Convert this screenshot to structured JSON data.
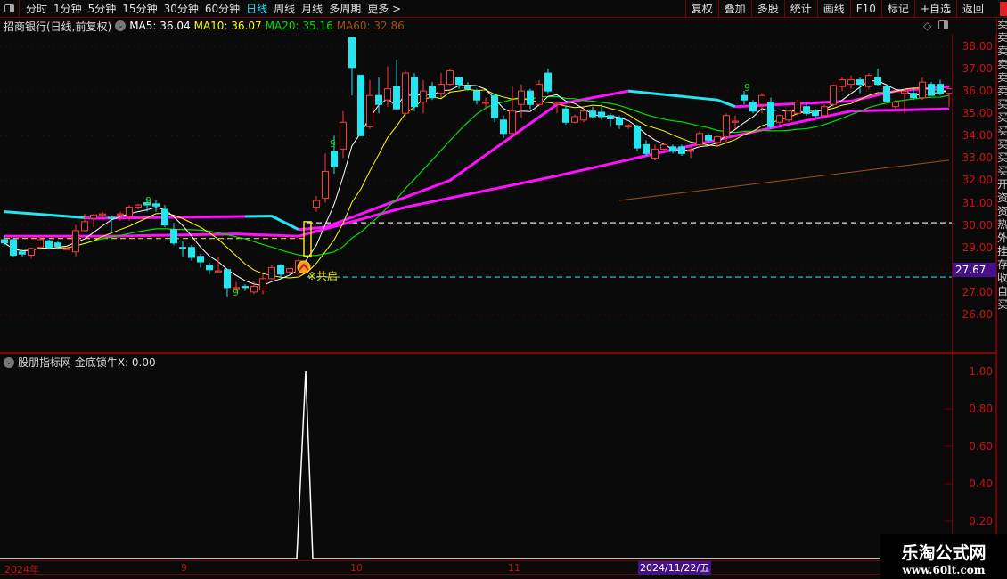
{
  "toolbar": {
    "periods": [
      "分时",
      "1分钟",
      "5分钟",
      "15分钟",
      "30分钟",
      "60分钟",
      "日线",
      "周线",
      "月线",
      "多周期",
      "更多 >"
    ],
    "active_period": "日线",
    "right_buttons": [
      "复权",
      "叠加",
      "多股",
      "统计",
      "画线",
      "F10",
      "标记",
      "+自选",
      "返回"
    ]
  },
  "title": {
    "stock": "招商银行(日线,前复权)",
    "ma5": "MA5: 36.04",
    "ma10": "MA10: 36.07",
    "ma20": "MA20: 35.16",
    "ma60": "MA60: 32.86"
  },
  "colors": {
    "up": "#ff3b3b",
    "down": "#22e6f0",
    "ma5": "#ffffff",
    "ma10": "#ffff00",
    "ma20": "#00e000",
    "ma60": "#a0501a",
    "band": "#ff10ff",
    "grid": "#6a0000",
    "accent": "#45108a"
  },
  "price_axis": [
    "38.00",
    "37.00",
    "36.00",
    "35.00",
    "34.00",
    "33.00",
    "32.00",
    "31.00",
    "30.00",
    "29.00",
    "27.00",
    "26.00"
  ],
  "current_price_tag": "27.67",
  "signal_label": "※共启",
  "nine_labels": [
    "9",
    "9",
    "9",
    "9"
  ],
  "right_strip": "卖卖卖卖卖卖买买买买买买开资资热外挂存收自买",
  "indicator": {
    "title": "股朋指标网 金底锁牛X: 0.00",
    "axis": [
      "1.00",
      "0.80",
      "0.60",
      "0.40",
      "0.20"
    ]
  },
  "date_axis": {
    "labels": [
      "2024年",
      "9",
      "10",
      "11"
    ],
    "selected": "2024/11/22/五"
  },
  "watermark": {
    "line1": "乐淘公式网",
    "line2": "www.60lt.com"
  },
  "chart_data": {
    "type": "candlestick",
    "ylim": [
      25.3,
      38.6
    ],
    "ohlc": [
      [
        29.35,
        29.5,
        29.1,
        29.2
      ],
      [
        29.35,
        29.4,
        28.55,
        28.65
      ],
      [
        28.8,
        28.9,
        28.6,
        28.7
      ],
      [
        28.65,
        29.0,
        28.5,
        28.95
      ],
      [
        29.0,
        29.5,
        28.9,
        29.35
      ],
      [
        29.3,
        29.35,
        28.9,
        29.0
      ],
      [
        29.2,
        29.3,
        28.9,
        29.05
      ],
      [
        28.95,
        29.0,
        28.9,
        28.95
      ],
      [
        28.8,
        30.0,
        28.6,
        29.75
      ],
      [
        29.75,
        30.5,
        29.7,
        30.15
      ],
      [
        30.3,
        30.5,
        29.9,
        30.45
      ],
      [
        30.45,
        30.6,
        30.3,
        30.5
      ],
      [
        30.35,
        30.4,
        29.6,
        30.3
      ],
      [
        30.45,
        30.6,
        30.2,
        30.5
      ],
      [
        30.4,
        30.9,
        30.2,
        30.8
      ],
      [
        30.8,
        30.95,
        30.7,
        30.9
      ],
      [
        31.0,
        31.2,
        30.6,
        30.9
      ],
      [
        30.95,
        31.1,
        30.6,
        30.85
      ],
      [
        30.7,
        30.9,
        29.9,
        30.0
      ],
      [
        29.8,
        30.1,
        29.1,
        29.2
      ],
      [
        29.0,
        29.3,
        28.6,
        28.95
      ],
      [
        29.0,
        29.1,
        28.4,
        28.55
      ],
      [
        28.6,
        28.7,
        28.1,
        28.35
      ],
      [
        28.2,
        28.3,
        27.8,
        28.0
      ],
      [
        27.9,
        28.6,
        27.9,
        27.95
      ],
      [
        28.0,
        28.0,
        26.8,
        27.2
      ],
      [
        27.2,
        27.45,
        27.0,
        27.2
      ],
      [
        27.25,
        27.35,
        27.05,
        27.2
      ],
      [
        27.0,
        27.5,
        26.9,
        27.25
      ],
      [
        27.1,
        27.8,
        26.9,
        27.6
      ],
      [
        27.6,
        28.2,
        27.55,
        28.1
      ],
      [
        28.2,
        28.25,
        27.6,
        27.8
      ],
      [
        27.9,
        28.05,
        27.8,
        28.05
      ],
      [
        27.85,
        28.5,
        27.8,
        28.4
      ],
      [
        28.6,
        30.15,
        28.6,
        30.15
      ],
      [
        30.8,
        31.3,
        30.6,
        31.1
      ],
      [
        31.2,
        33.2,
        31.0,
        32.4
      ],
      [
        33.3,
        34.0,
        32.3,
        32.6
      ],
      [
        33.4,
        35.1,
        33.0,
        34.6
      ],
      [
        38.4,
        38.4,
        35.8,
        37.05
      ],
      [
        36.7,
        36.7,
        34.0,
        34.0
      ],
      [
        34.4,
        36.5,
        34.3,
        35.8
      ],
      [
        35.8,
        36.6,
        35.0,
        35.4
      ],
      [
        35.6,
        37.1,
        35.3,
        36.1
      ],
      [
        36.2,
        37.4,
        35.3,
        35.2
      ],
      [
        35.0,
        36.9,
        34.9,
        36.8
      ],
      [
        36.6,
        36.8,
        35.1,
        35.3
      ],
      [
        35.5,
        36.5,
        35.0,
        36.0
      ],
      [
        36.2,
        36.4,
        35.6,
        35.7
      ],
      [
        35.9,
        36.8,
        35.7,
        36.3
      ],
      [
        36.3,
        37.0,
        36.2,
        36.9
      ],
      [
        36.6,
        36.6,
        36.1,
        36.3
      ],
      [
        36.2,
        36.4,
        36.0,
        36.1
      ],
      [
        36.0,
        36.1,
        35.4,
        35.6
      ],
      [
        35.5,
        35.7,
        35.2,
        35.5
      ],
      [
        35.8,
        35.9,
        34.6,
        34.8
      ],
      [
        34.7,
        34.9,
        33.9,
        34.1
      ],
      [
        34.1,
        36.2,
        34.1,
        35.1
      ],
      [
        35.4,
        36.3,
        34.8,
        36.0
      ],
      [
        36.0,
        36.1,
        35.2,
        35.4
      ],
      [
        35.4,
        36.5,
        35.3,
        36.3
      ],
      [
        36.8,
        37.0,
        35.9,
        36.0
      ],
      [
        35.4,
        35.5,
        35.0,
        35.45
      ],
      [
        35.2,
        35.3,
        34.5,
        34.6
      ],
      [
        34.6,
        34.95,
        34.55,
        34.85
      ],
      [
        34.7,
        35.2,
        34.6,
        35.1
      ],
      [
        35.1,
        35.3,
        34.8,
        34.85
      ],
      [
        35.05,
        35.4,
        34.7,
        34.85
      ],
      [
        34.9,
        35.0,
        34.4,
        34.75
      ],
      [
        34.8,
        34.9,
        34.3,
        34.5
      ],
      [
        34.4,
        34.5,
        34.3,
        34.45
      ],
      [
        34.4,
        34.5,
        33.3,
        33.45
      ],
      [
        33.6,
        33.8,
        33.1,
        33.2
      ],
      [
        33.0,
        33.6,
        32.9,
        33.4
      ],
      [
        33.4,
        33.7,
        33.3,
        33.6
      ],
      [
        33.5,
        33.6,
        33.2,
        33.3
      ],
      [
        33.5,
        33.6,
        33.1,
        33.2
      ],
      [
        33.3,
        33.5,
        33.0,
        33.35
      ],
      [
        33.6,
        34.2,
        33.5,
        34.1
      ],
      [
        34.0,
        34.1,
        33.7,
        33.8
      ],
      [
        33.7,
        34.0,
        33.5,
        33.95
      ],
      [
        33.95,
        35.0,
        33.7,
        34.9
      ],
      [
        34.6,
        34.9,
        34.3,
        34.65
      ],
      [
        35.8,
        36.0,
        35.4,
        35.6
      ],
      [
        35.5,
        35.6,
        35.0,
        35.1
      ],
      [
        35.4,
        35.9,
        35.0,
        35.8
      ],
      [
        35.5,
        35.7,
        34.3,
        34.4
      ],
      [
        34.6,
        34.95,
        34.5,
        34.9
      ],
      [
        34.7,
        35.15,
        34.6,
        35.1
      ],
      [
        35.0,
        35.6,
        34.9,
        35.5
      ],
      [
        35.3,
        35.4,
        34.9,
        35.0
      ],
      [
        35.1,
        35.2,
        34.8,
        34.9
      ],
      [
        34.9,
        35.4,
        34.8,
        35.3
      ],
      [
        35.4,
        36.3,
        35.3,
        36.25
      ],
      [
        36.2,
        36.6,
        36.0,
        36.5
      ],
      [
        36.3,
        36.7,
        36.1,
        36.5
      ],
      [
        36.5,
        36.6,
        35.9,
        36.3
      ],
      [
        36.2,
        36.8,
        36.1,
        36.7
      ],
      [
        36.6,
        37.0,
        36.2,
        36.3
      ],
      [
        36.2,
        36.3,
        35.5,
        35.55
      ],
      [
        35.3,
        35.6,
        35.2,
        35.5
      ],
      [
        35.9,
        36.1,
        35.0,
        36.0
      ],
      [
        35.9,
        36.1,
        35.6,
        35.7
      ],
      [
        35.7,
        36.6,
        35.6,
        36.4
      ],
      [
        36.3,
        36.4,
        35.8,
        35.8
      ],
      [
        36.3,
        36.5,
        35.8,
        35.9
      ],
      [
        35.9,
        36.1,
        35.3,
        36.1
      ]
    ],
    "signal_index": 34,
    "upper_band": [
      [
        0,
        30.6
      ],
      [
        10,
        30.3
      ],
      [
        30,
        30.4
      ],
      [
        33,
        29.8
      ],
      [
        36,
        29.9
      ],
      [
        40,
        30.5
      ],
      [
        50,
        32.0
      ],
      [
        62,
        35.4
      ],
      [
        70,
        36.0
      ],
      [
        80,
        35.6
      ],
      [
        82,
        35.3
      ],
      [
        95,
        35.55
      ],
      [
        100,
        36.0
      ],
      [
        106,
        36.2
      ]
    ],
    "upper_band_colors": [
      [
        "down",
        0,
        9
      ],
      [
        "band",
        9,
        27
      ],
      [
        "down",
        27,
        33
      ],
      [
        "band",
        33,
        70
      ],
      [
        "down",
        70,
        82
      ],
      [
        "band",
        82,
        106
      ]
    ],
    "lower_band": [
      [
        0,
        29.5
      ],
      [
        12,
        29.5
      ],
      [
        26,
        29.6
      ],
      [
        33,
        29.5
      ],
      [
        45,
        30.8
      ],
      [
        62,
        32.2
      ],
      [
        82,
        34.0
      ],
      [
        95,
        35.1
      ],
      [
        106,
        35.2
      ]
    ],
    "ma60_line": [
      [
        69,
        31.1
      ],
      [
        106,
        32.9
      ]
    ],
    "dashed_levels": [
      {
        "price": 30.1,
        "color": "#e0e0e0",
        "from": 34,
        "to": 106
      },
      {
        "price": 29.4,
        "color": "#e8d800",
        "from": 0,
        "to": 34
      },
      {
        "price": 27.67,
        "color": "#22d8e0",
        "from": 34,
        "to": 106
      }
    ],
    "indicator_series": {
      "spike_index": 33.8,
      "value": 1.0,
      "ylim": [
        0,
        1.05
      ]
    }
  }
}
